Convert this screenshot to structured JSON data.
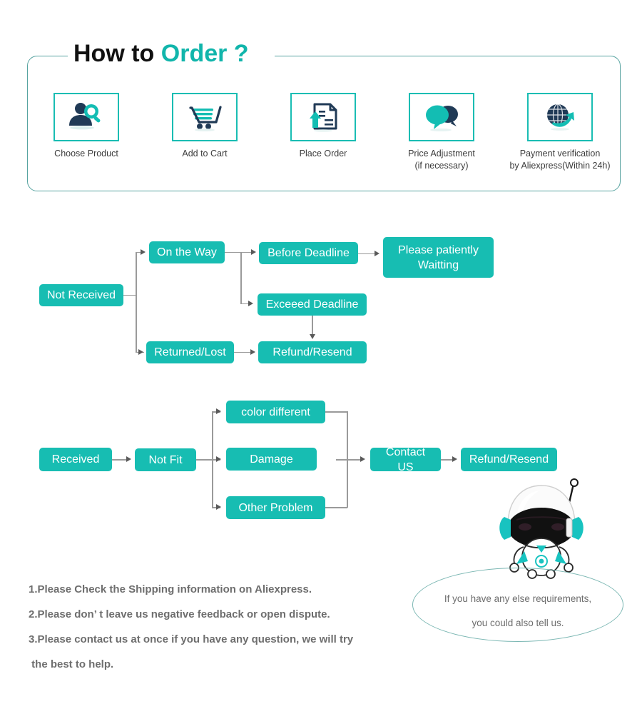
{
  "header": {
    "title_black": "How to ",
    "title_teal": "Order ?",
    "border_color": "#57a3a0",
    "accent_color": "#11b5ab",
    "steps": [
      {
        "icon": "person-search-icon",
        "label": "Choose  Product",
        "sub": ""
      },
      {
        "icon": "shopping-cart-icon",
        "label": "Add to Cart",
        "sub": ""
      },
      {
        "icon": "document-upload-icon",
        "label": "Place  Order",
        "sub": ""
      },
      {
        "icon": "chat-bubbles-icon",
        "label": "Price Adjustment",
        "sub": "(if necessary)"
      },
      {
        "icon": "globe-arrow-icon",
        "label": "Payment verification",
        "sub": "by Aliexpress(Within 24h)"
      }
    ]
  },
  "flow_not_received": {
    "node_color": "#17bdb2",
    "nodes": {
      "not_received": "Not Received",
      "on_the_way": "On the Way",
      "before_deadline": "Before Deadline",
      "please_wait": "Please patiently\nWaitting",
      "exceed_deadline": "Exceeed Deadline",
      "returned_lost": "Returned/Lost",
      "refund_resend": "Refund/Resend"
    }
  },
  "flow_received": {
    "node_color": "#17bdb2",
    "nodes": {
      "received": "Received",
      "not_fit": "Not Fit",
      "color_different": "color different",
      "damage": "Damage",
      "other_problem": "Other Problem",
      "contact_us": "Contact US",
      "refund_resend": "Refund/Resend"
    }
  },
  "notes": {
    "line1": "1.Please Check the Shipping information on Aliexpress.",
    "line2": "2.Please don’ t leave us negative feedback or open dispute.",
    "line3": "3.Please contact us at once if you have any question, we will try",
    "line4": " the best to help."
  },
  "bubble": {
    "line1": "If you have any else requirements,",
    "line2": "you could also tell us.",
    "border_color": "#7bb7b3"
  },
  "mascot": {
    "name": "astronaut-mascot"
  }
}
